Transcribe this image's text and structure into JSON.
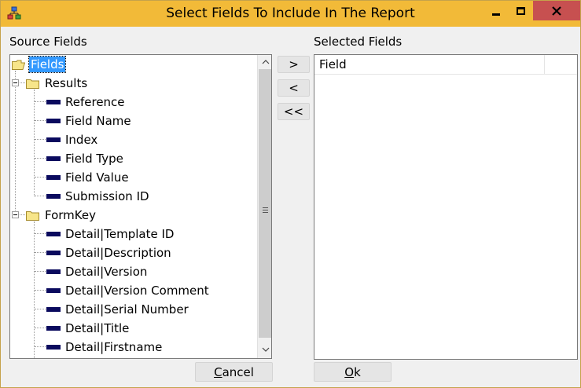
{
  "window": {
    "title": "Select Fields To Include In The Report",
    "app_icon": "report-app-icon",
    "controls": {
      "minimize": "minimize-icon",
      "maximize": "maximize-icon",
      "close": "close-icon"
    },
    "titlebar_color": "#f2ba38",
    "close_color": "#c75050"
  },
  "source": {
    "label": "Source Fields",
    "root": "Fields",
    "groups": [
      {
        "name": "Results",
        "items": [
          "Reference",
          "Field Name",
          "Index",
          "Field Type",
          "Field Value",
          "Submission ID"
        ]
      },
      {
        "name": "FormKey",
        "items": [
          "Detail|Template ID",
          "Detail|Description",
          "Detail|Version",
          "Detail|Version Comment",
          "Detail|Serial Number",
          "Detail|Title",
          "Detail|Firstname"
        ]
      }
    ],
    "scrollbar": {
      "up": "▲",
      "down": "▼",
      "grip": "≡"
    }
  },
  "move_buttons": {
    "add": ">",
    "remove": "<",
    "remove_all": "<<"
  },
  "selected": {
    "label": "Selected Fields",
    "columns": [
      "Field",
      ""
    ]
  },
  "buttons": {
    "cancel": {
      "mnemonic": "C",
      "rest": "ancel"
    },
    "ok": {
      "mnemonic": "O",
      "rest": "k"
    }
  }
}
